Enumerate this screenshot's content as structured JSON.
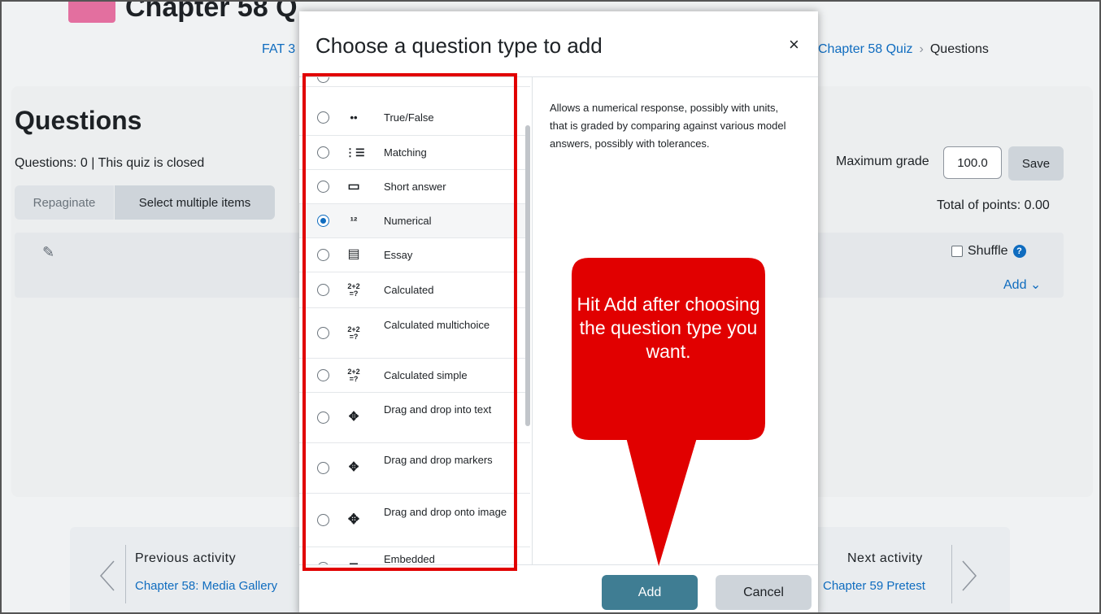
{
  "page": {
    "course_title": "Chapter 58 Q",
    "breadcrumb_left": "FAT 3",
    "breadcrumb_right": [
      "Chapter 58 Quiz",
      "Questions"
    ],
    "heading": "Questions",
    "info": "Questions: 0 | This quiz is closed",
    "repaginate_label": "Repaginate",
    "select_multiple_label": "Select multiple items",
    "max_grade_label": "Maximum grade",
    "max_grade_value": "100.0",
    "save_label": "Save",
    "total_points": "Total of points: 0.00",
    "shuffle_label": "Shuffle",
    "add_label": "Add ⌄",
    "prev_label": "Previous activity",
    "prev_link": "Chapter 58: Media Gallery",
    "next_label": "Next activity",
    "next_link": "Chapter 59 Pretest"
  },
  "modal": {
    "title": "Choose a question type to add",
    "close_label": "×",
    "description": "Allows a numerical response, possibly with units, that is graded by comparing against various model answers, possibly with tolerances.",
    "add_label": "Add",
    "cancel_label": "Cancel",
    "question_types": [
      {
        "label": "True/False",
        "icon": "••",
        "selected": false
      },
      {
        "label": "Matching",
        "icon": "⋮☰",
        "selected": false
      },
      {
        "label": "Short answer",
        "icon": "▭",
        "selected": false
      },
      {
        "label": "Numerical",
        "icon": "¹²",
        "selected": true
      },
      {
        "label": "Essay",
        "icon": "▤",
        "selected": false
      },
      {
        "label": "Calculated",
        "icon": "2+2=?",
        "selected": false
      },
      {
        "label": "Calculated multichoice",
        "icon": "2+2=?",
        "selected": false
      },
      {
        "label": "Calculated simple",
        "icon": "2+2=?",
        "selected": false
      },
      {
        "label": "Drag and drop into text",
        "icon": "✥",
        "selected": false
      },
      {
        "label": "Drag and drop markers",
        "icon": "✥",
        "selected": false
      },
      {
        "label": "Drag and drop onto image",
        "icon": "✥",
        "selected": false
      },
      {
        "label": "Embedded",
        "icon": "☰",
        "selected": false
      }
    ]
  },
  "callout": {
    "text": "Hit Add after choosing the question type you want.",
    "color": "#e10000"
  }
}
